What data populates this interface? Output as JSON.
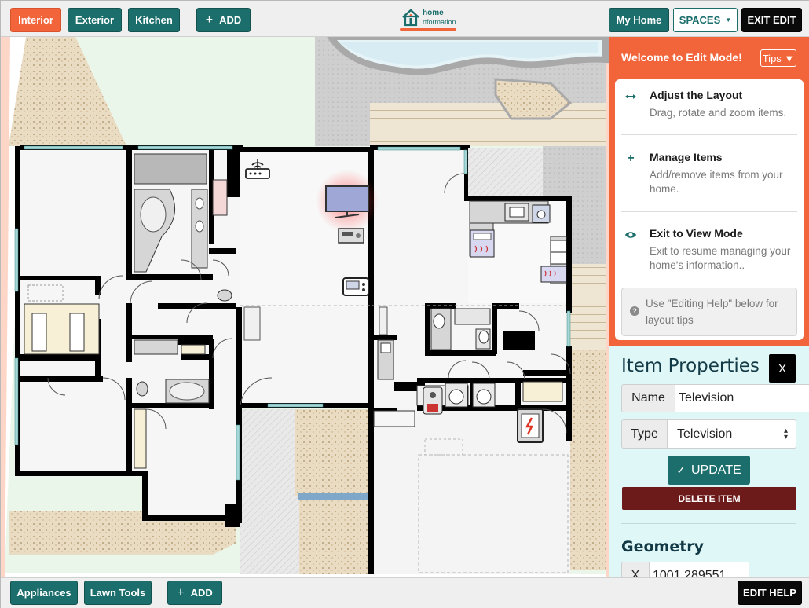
{
  "topbar": {
    "tabs": [
      {
        "label": "Interior",
        "active": true
      },
      {
        "label": "Exterior",
        "active": false
      },
      {
        "label": "Kitchen",
        "active": false
      }
    ],
    "add_label": "ADD",
    "logo_line1": "home",
    "logo_line2": "nformation",
    "my_home_label": "My Home",
    "spaces_label": "SPACES",
    "exit_edit_label": "EXIT EDIT"
  },
  "tips": {
    "welcome": "Welcome to Edit Mode!",
    "toggle_label": "Tips ▼",
    "items": [
      {
        "icon": "drag-hand-icon",
        "title": "Adjust the Layout",
        "desc": "Drag, rotate and zoom items."
      },
      {
        "icon": "plus-icon",
        "title": "Manage Items",
        "desc": "Add/remove items from your home."
      },
      {
        "icon": "eye-icon",
        "title": "Exit to View Mode",
        "desc": "Exit to resume managing your home's information.."
      }
    ],
    "hint": "Use \"Editing Help\" below for layout tips"
  },
  "item_properties": {
    "title": "Item Properties",
    "close_label": "X",
    "name_label": "Name",
    "name_value": "Television",
    "type_label": "Type",
    "type_value": "Television",
    "update_label": "UPDATE",
    "delete_label": "DELETE ITEM",
    "geometry_title": "Geometry",
    "x_label": "X",
    "x_value": "1001.289551"
  },
  "bottombar": {
    "tabs": [
      "Appliances",
      "Lawn Tools"
    ],
    "add_label": "ADD",
    "edit_help_label": "EDIT HELP"
  },
  "colors": {
    "teal": "#1b6e6c",
    "orange": "#f2643a",
    "black": "#0a0a0a",
    "delete_red": "#6d1a1a",
    "props_bg": "#e0f7f7"
  }
}
